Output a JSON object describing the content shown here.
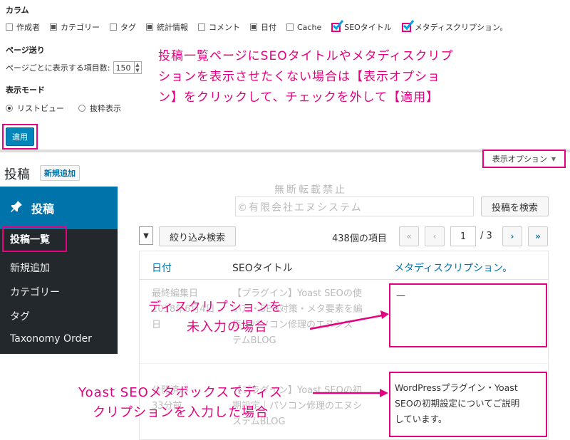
{
  "screen_options": {
    "columns_heading": "カラム",
    "columns": [
      {
        "label": "作成者",
        "checked": false
      },
      {
        "label": "カテゴリー",
        "checked": true
      },
      {
        "label": "タグ",
        "checked": false
      },
      {
        "label": "統計情報",
        "checked": true
      },
      {
        "label": "コメント",
        "checked": false
      },
      {
        "label": "日付",
        "checked": true
      },
      {
        "label": "Cache",
        "checked": false
      },
      {
        "label": "SEOタイトル",
        "checked": true
      },
      {
        "label": "メタディスクリプション。",
        "checked": true
      }
    ],
    "pagination_heading": "ページ送り",
    "per_page_label": "ページごとに表示する項目数:",
    "per_page_value": "150",
    "view_mode_heading": "表示モード",
    "view_list": "リストビュー",
    "view_excerpt": "抜粋表示",
    "apply_label": "適用"
  },
  "annotations": {
    "note_top_1": "投稿一覧ページにSEOタイトルやメタディスクリプ",
    "note_top_2": "ションを表示させたくない場合は【表示オプショ",
    "note_top_3": "ン】をクリックして、チェックを外して【適用】",
    "note_mid_1": "ディスクリプションを",
    "note_mid_2": "未入力の場合",
    "note_bot_1": "Yoast SEOメタボックスでディス",
    "note_bot_2": "クリプションを入力した場合"
  },
  "watermark": {
    "line1": "無断転載禁止",
    "line2": "©有限会社エヌシステム"
  },
  "posts_page": {
    "screen_options_tab": "表示オプション",
    "title": "投稿",
    "add_new": "新規追加",
    "search_button": "投稿を検索",
    "filter_button": "絞り込み検索",
    "item_count": "438個の項目",
    "page_first": "«",
    "page_prev": "‹",
    "page_current": "1",
    "page_total": "/ 3",
    "page_next": "›",
    "page_last": "»"
  },
  "sidebar": {
    "header": "投稿",
    "items": [
      "投稿一覧",
      "新規追加",
      "カテゴリー",
      "タグ",
      "Taxonomy Order"
    ]
  },
  "table": {
    "col_date": "日付",
    "col_seo_title": "SEOタイトル",
    "col_meta_desc": "メタディスクリプション。",
    "row1": {
      "date_1": "最終編集日",
      "date_2": "2018年6月4日",
      "date_3": "日",
      "title_1": "【プラグイン】Yoast SEOの使",
      "title_2": "い方・SEO対策・メタ要素を編",
      "title_3": "集｜パソコン修理のエヌシス",
      "title_4": "テムBLOG",
      "desc": "—"
    },
    "row2": {
      "date_1": "公開済み",
      "date_2": "33分前",
      "title_1": "【プラグイン】Yoast SEOの初",
      "title_2": "期設定｜パソコン修理のエヌシ",
      "title_3": "ステムBLOG",
      "desc_1": "WordPressプラグイン・Yoast",
      "desc_2": "SEOの初期設定についてご説明",
      "desc_3": "しています。"
    }
  },
  "colors": {
    "accent_pink": "#e4007f",
    "wp_blue": "#0073aa",
    "sidebar_dark": "#23282d"
  }
}
